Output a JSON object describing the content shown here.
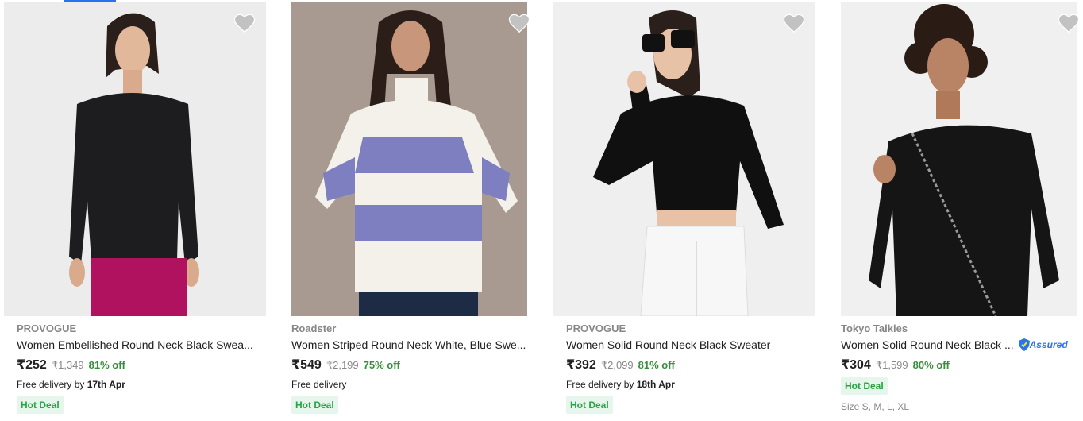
{
  "colors": {
    "accent": "#2874f0",
    "discount": "#388e3c",
    "hot_deal_bg": "#e6f6ec",
    "hot_deal_text": "#26a541"
  },
  "products": [
    {
      "brand": "PROVOGUE",
      "title": "Women Embellished Round Neck Black Swea...",
      "price": "₹252",
      "mrp": "₹1,349",
      "discount": "81% off",
      "delivery_text": "Free delivery by ",
      "delivery_date": "17th Apr",
      "badge": "Hot Deal"
    },
    {
      "brand": "Roadster",
      "title": "Women Striped Round Neck White, Blue Swe...",
      "price": "₹549",
      "mrp": "₹2,199",
      "discount": "75% off",
      "delivery_text": "Free delivery",
      "delivery_date": "",
      "badge": "Hot Deal"
    },
    {
      "brand": "PROVOGUE",
      "title": "Women Solid Round Neck Black Sweater",
      "price": "₹392",
      "mrp": "₹2,099",
      "discount": "81% off",
      "delivery_text": "Free delivery by ",
      "delivery_date": "18th Apr",
      "badge": "Hot Deal"
    },
    {
      "brand": "Tokyo Talkies",
      "title": "Women Solid Round Neck Black ...",
      "assured": "Assured",
      "price": "₹304",
      "mrp": "₹1,599",
      "discount": "80% off",
      "badge": "Hot Deal",
      "sizes": "Size S, M, L, XL"
    }
  ]
}
